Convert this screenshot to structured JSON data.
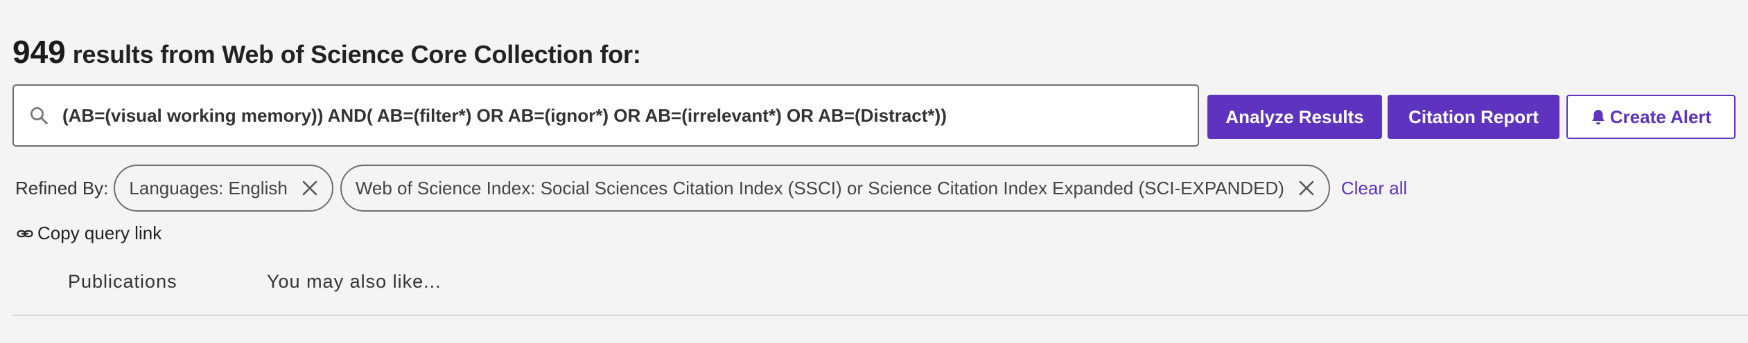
{
  "header": {
    "count": "949",
    "text": "results from Web of Science Core Collection for:"
  },
  "search": {
    "query": "(AB=(visual working memory)) AND( AB=(filter*) OR AB=(ignor*) OR AB=(irrelevant*) OR AB=(Distract*))",
    "icon": "search-icon"
  },
  "actions": {
    "analyze_label": "Analyze Results",
    "citation_label": "Citation Report",
    "alert_label": "Create Alert",
    "alert_icon": "bell-icon"
  },
  "refine": {
    "label": "Refined By:",
    "chips": [
      "Languages: English",
      "Web of Science Index: Social Sciences Citation Index (SSCI) or Science Citation Index Expanded (SCI-EXPANDED)"
    ],
    "clear_label": "Clear all"
  },
  "copy_link": {
    "label": "Copy query link",
    "icon": "link-icon"
  },
  "tabs": [
    {
      "label": "Publications"
    },
    {
      "label": "You may also like..."
    }
  ],
  "colors": {
    "accent": "#5e33bf",
    "background": "#f4f4f4",
    "border": "#6e6e6e"
  }
}
